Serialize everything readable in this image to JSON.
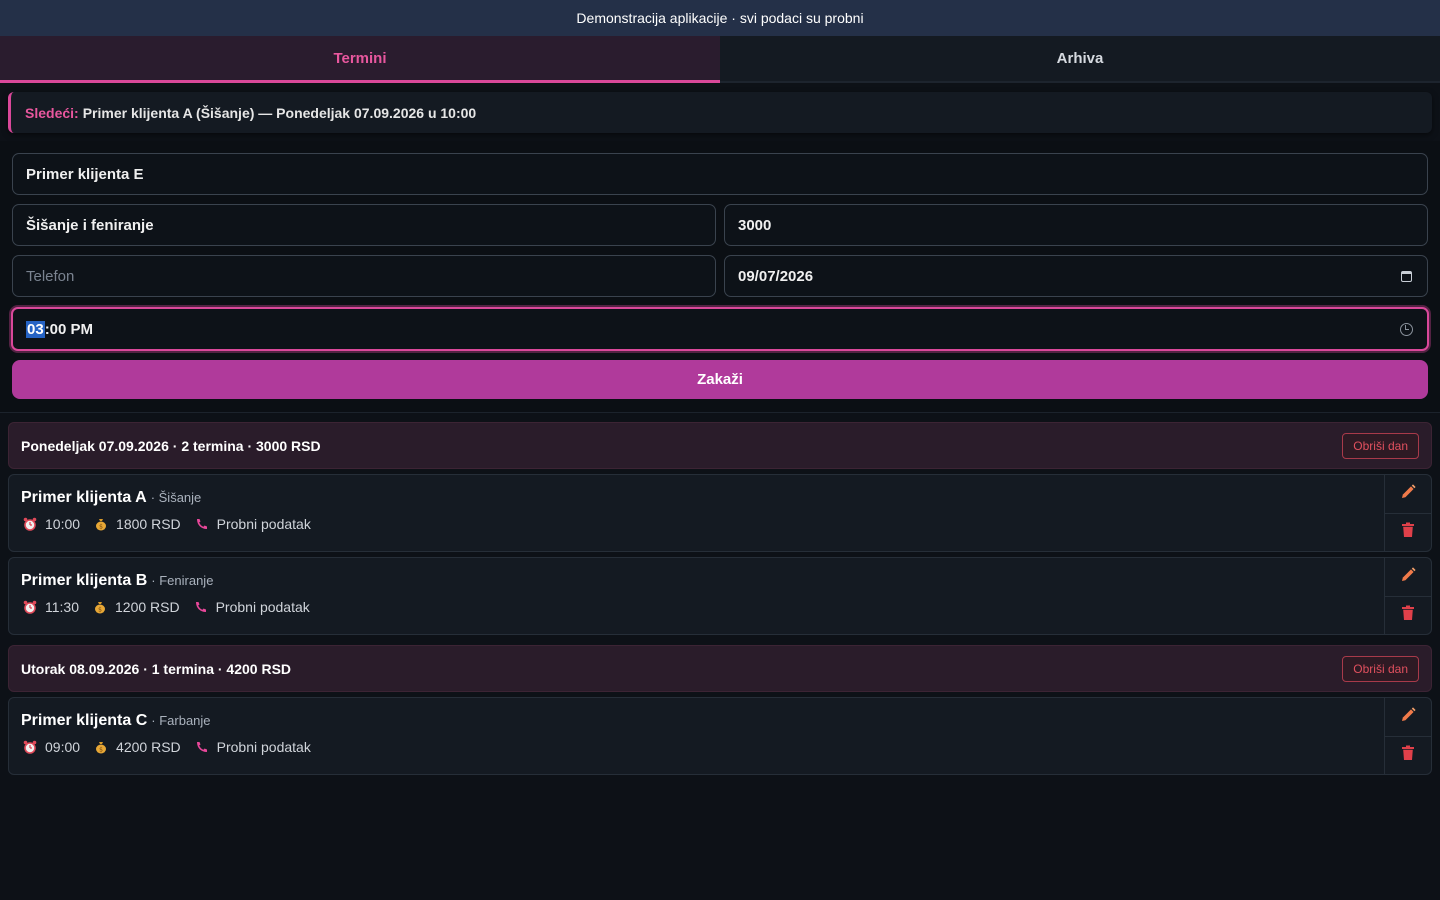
{
  "banner": {
    "text": "Demonstracija aplikacije · svi podaci su probni"
  },
  "tabs": [
    {
      "label": "Termini",
      "active": true
    },
    {
      "label": "Arhiva",
      "active": false
    }
  ],
  "next": {
    "label": "Sledeći:",
    "text": "Primer klijenta A (Šišanje) — Ponedeljak 07.09.2026 u 10:00"
  },
  "form": {
    "name_value": "Primer klijenta E",
    "service_value": "Šišanje i feniranje",
    "price_value": "3000",
    "phone_placeholder": "Telefon",
    "date_value": "09/07/2026",
    "time_hour_selected": "03",
    "time_rest": ":00 PM",
    "submit_label": "Zakaži"
  },
  "days": [
    {
      "header": "Ponedeljak 07.09.2026 · 2 termina · 3000 RSD",
      "delete_label": "Obriši dan",
      "appointments": [
        {
          "name": "Primer klijenta A",
          "service": "· Šišanje",
          "time": "10:00",
          "price": "1800 RSD",
          "phone": "Probni podatak"
        },
        {
          "name": "Primer klijenta B",
          "service": "· Feniranje",
          "time": "11:30",
          "price": "1200 RSD",
          "phone": "Probni podatak"
        }
      ]
    },
    {
      "header": "Utorak 08.09.2026 · 1 termina · 4200 RSD",
      "delete_label": "Obriši dan",
      "appointments": [
        {
          "name": "Primer klijenta C",
          "service": "· Farbanje",
          "time": "09:00",
          "price": "4200 RSD",
          "phone": "Probni podatak"
        }
      ]
    }
  ],
  "colors": {
    "accent": "#d9489a",
    "button": "#b03a9b",
    "danger": "#e0505e",
    "edit": "#f07a4a"
  },
  "icons": {
    "time": "alarm-clock-icon",
    "price": "money-bag-icon",
    "phone": "phone-icon",
    "edit": "pencil-icon",
    "delete": "trash-icon"
  }
}
